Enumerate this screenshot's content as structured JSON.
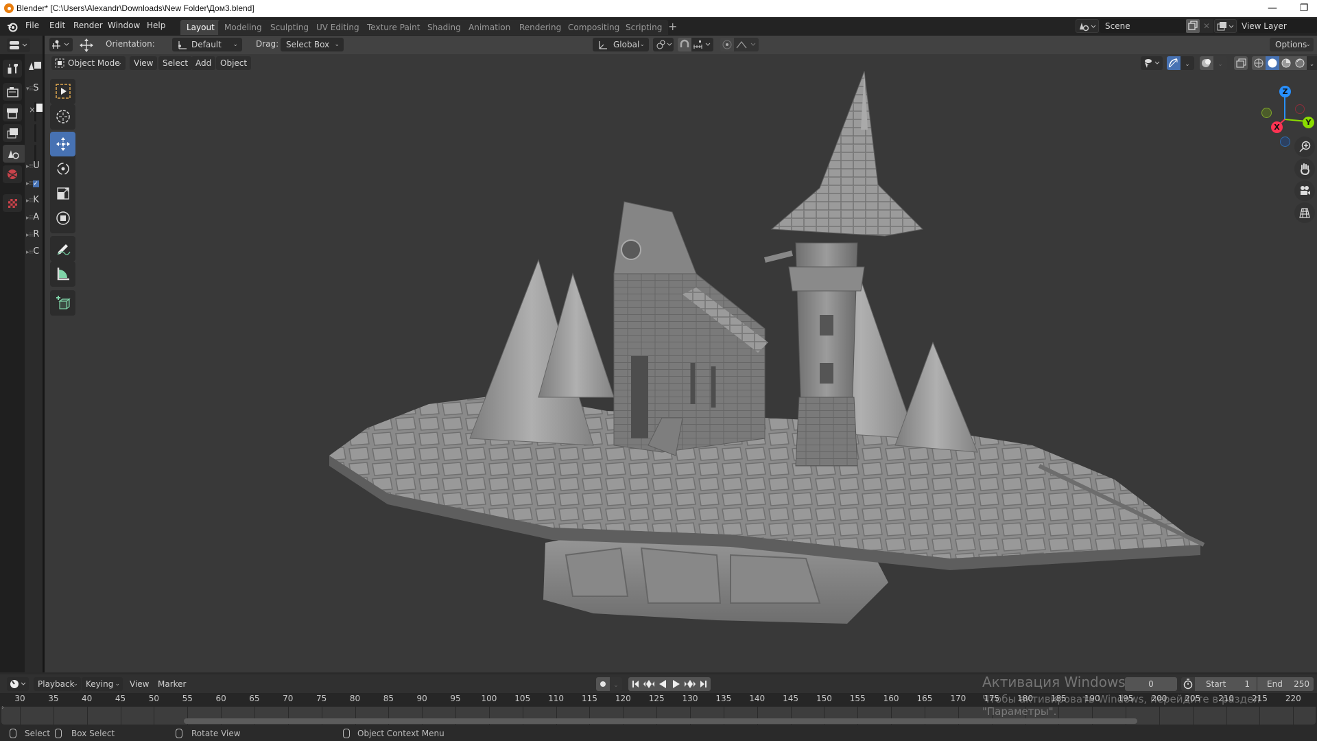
{
  "titlebar": {
    "title": "Blender* [C:\\Users\\Alexandr\\Downloads\\New Folder\\Дом3.blend]",
    "minimize_glyph": "—",
    "restore_glyph": "❐"
  },
  "menu": {
    "items": [
      "File",
      "Edit",
      "Render",
      "Window",
      "Help"
    ]
  },
  "workspaces": {
    "tabs": [
      "Layout",
      "Modeling",
      "Sculpting",
      "UV Editing",
      "Texture Paint",
      "Shading",
      "Animation",
      "Rendering",
      "Compositing",
      "Scripting"
    ],
    "active": "Layout",
    "add_glyph": "+"
  },
  "scene": {
    "scene_name": "Scene",
    "view_layer": "View Layer"
  },
  "tool_header": {
    "orientation_label": "Orientation:",
    "orientation_value": "Default",
    "drag_label": "Drag:",
    "drag_value": "Select Box",
    "transform_orientation": "Global",
    "options_label": "Options"
  },
  "viewport_header": {
    "mode": "Object Mode",
    "menus": [
      "View",
      "Select",
      "Add",
      "Object"
    ],
    "shading_active": "Solid"
  },
  "outliner": {
    "rows": [
      "S",
      "U",
      "",
      "K",
      "A",
      "R",
      "C"
    ]
  },
  "gizmo": {
    "x": "X",
    "y": "Y",
    "z": "Z",
    "colors": {
      "x": "#ff3352",
      "y": "#8bdc00",
      "z": "#2890ff"
    }
  },
  "toolbar": {
    "tools": [
      "select-box",
      "cursor",
      "move",
      "rotate",
      "scale",
      "transform",
      "annotate",
      "measure",
      "add-cube"
    ],
    "active": "move"
  },
  "timeline": {
    "menus": [
      "Playback",
      "Keying",
      "View",
      "Marker"
    ],
    "current_frame": "0",
    "start_label": "Start",
    "start_value": "1",
    "end_label": "End",
    "end_value": "250",
    "ticks": [
      "30",
      "35",
      "40",
      "45",
      "50",
      "55",
      "60",
      "65",
      "70",
      "75",
      "80",
      "85",
      "90",
      "95",
      "100",
      "105",
      "110",
      "115",
      "120",
      "125",
      "130",
      "135",
      "140",
      "145",
      "150",
      "155",
      "160",
      "165",
      "170",
      "175",
      "180",
      "185",
      "190",
      "195",
      "200",
      "205",
      "210",
      "215",
      "220"
    ]
  },
  "watermark": {
    "line1": "Активация Windows",
    "line2": "Чтобы активировать Windows, перейдите в раздел \"Параметры\"."
  },
  "status_bar": {
    "select": "Select",
    "box_select": "Box Select",
    "rotate_view": "Rotate View",
    "context_menu": "Object Context Menu"
  },
  "colors": {
    "accent": "#4772b3",
    "viewport_bg": "#393939",
    "header_bg": "#232323"
  }
}
